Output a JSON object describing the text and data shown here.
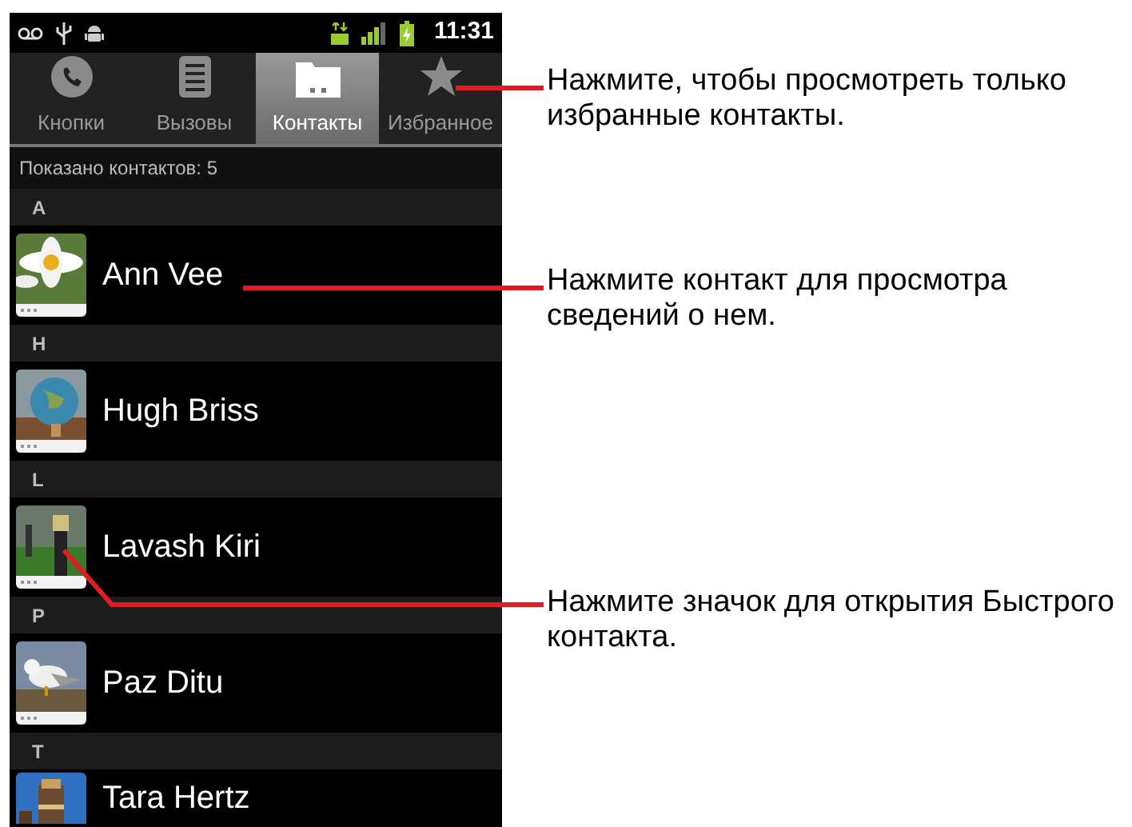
{
  "status_bar": {
    "time": "11:31"
  },
  "tabs": [
    {
      "label": "Кнопки",
      "kind": "dialer",
      "selected": false
    },
    {
      "label": "Вызовы",
      "kind": "calllog",
      "selected": false
    },
    {
      "label": "Контакты",
      "kind": "contacts",
      "selected": true
    },
    {
      "label": "Избранное",
      "kind": "favorites",
      "selected": false
    }
  ],
  "contacts_count": "Показано контактов: 5",
  "sections": [
    {
      "letter": "A",
      "contacts": [
        {
          "name": "Ann Vee"
        }
      ]
    },
    {
      "letter": "H",
      "contacts": [
        {
          "name": "Hugh Briss"
        }
      ]
    },
    {
      "letter": "L",
      "contacts": [
        {
          "name": "Lavash Kiri"
        }
      ]
    },
    {
      "letter": "P",
      "contacts": [
        {
          "name": "Paz Ditu"
        }
      ]
    },
    {
      "letter": "T",
      "contacts": [
        {
          "name": "Tara Hertz"
        }
      ]
    }
  ],
  "callouts": [
    {
      "text": "Нажмите, чтобы просмотреть только избранные контакты."
    },
    {
      "text": "Нажмите контакт для просмотра сведений о нем."
    },
    {
      "text": "Нажмите значок для открытия Быстрого контакта."
    }
  ]
}
